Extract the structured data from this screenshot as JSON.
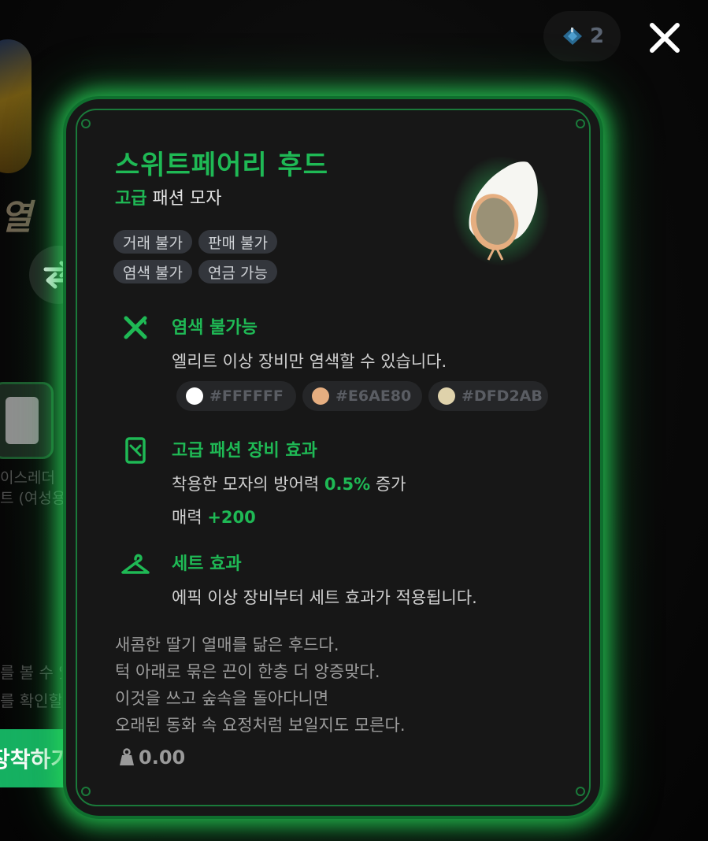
{
  "background": {
    "title_fragment": "열",
    "item_name_lines": [
      "이스레더",
      "트 (여성용"
    ],
    "desc_lines": [
      "를 볼 수 있",
      "를 확인할"
    ],
    "equip_label": "장착하기"
  },
  "header": {
    "currency_count": "2",
    "currency_icon": "ticket-icon",
    "close_icon": "close-icon"
  },
  "item": {
    "name": "스위트페어리 후드",
    "grade": "고급",
    "category": "패션 모자",
    "tags": [
      "거래 불가",
      "판매 불가",
      "염색 불가",
      "연금 가능"
    ],
    "dye": {
      "title": "염색 불가능",
      "desc": "엘리트 이상 장비만 염색할 수 있습니다.",
      "colors": [
        {
          "code": "#FFFFFF",
          "hex": "#FFFFFF"
        },
        {
          "code": "#E6AE80",
          "hex": "#E6AE80"
        },
        {
          "code": "#DFD2AB",
          "hex": "#DFD2AB"
        }
      ]
    },
    "effect": {
      "title": "고급 패션 장비 효과",
      "line1_prefix": "착용한 모자의 방어력 ",
      "line1_value": "0.5%",
      "line1_suffix": " 증가",
      "line2_prefix": "매력 ",
      "line2_value": "+200"
    },
    "set": {
      "title": "세트 효과",
      "desc": "에픽 이상 장비부터 세트 효과가 적용됩니다."
    },
    "flavor": [
      "새콤한 딸기 열매를 닮은 후드다.",
      "턱 아래로 묶은 끈이 한층 더 앙증맞다.",
      "이것을 쓰고 숲속을 돌아다니면",
      "오래된 동화 속 요정처럼 보일지도 모른다."
    ],
    "weight": "0.00"
  },
  "colors": {
    "accent": "#1FB955",
    "glow": "#28DC5A",
    "button": "#16B162"
  }
}
